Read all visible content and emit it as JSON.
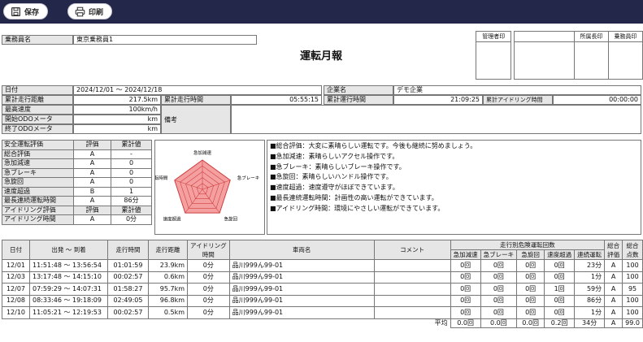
{
  "toolbar": {
    "save_label": "保存",
    "print_label": "印刷"
  },
  "driver": {
    "label": "乗務員名",
    "value": "東京乗務員1"
  },
  "report_title": "運転月報",
  "stamps": [
    "管理者印",
    "所属長印",
    "乗務員印"
  ],
  "period": {
    "label": "日付",
    "value": "2024/12/01 ～ 2024/12/18"
  },
  "company": {
    "label": "企業名",
    "value": "デモ企業"
  },
  "summary": {
    "distance_label": "累計走行距離",
    "distance": "217.5km",
    "drive_time_label": "累計走行時間",
    "drive_time": "05:55:15",
    "op_time_label": "累計運行時間",
    "op_time": "21:09:25",
    "idle_label": "累計アイドリング時間",
    "idle": "00:00:00",
    "max_speed_label": "最高速度",
    "max_speed": "100km/h",
    "start_odo_label": "開始ODOメータ",
    "start_odo": "km",
    "end_odo_label": "終了ODOメータ",
    "end_odo": "km",
    "remarks_label": "備考"
  },
  "evaluation": {
    "header": [
      "安全運転評価",
      "評価",
      "累計値"
    ],
    "rows": [
      [
        "総合評価",
        "A",
        "-"
      ],
      [
        "急加減速",
        "A",
        "0"
      ],
      [
        "急ブレーキ",
        "A",
        "0"
      ],
      [
        "急旋回",
        "A",
        "0"
      ],
      [
        "速度超過",
        "B",
        "1"
      ],
      [
        "最長連続運転時間",
        "A",
        "86分"
      ]
    ],
    "idle_header": [
      "アイドリング評価",
      "評価",
      "累計値"
    ],
    "idle_row": [
      "アイドリング時間",
      "A",
      "0分"
    ]
  },
  "radar": {
    "axes": [
      "急加減速",
      "急ブレーキ",
      "急旋回",
      "速度超過",
      "運転時間"
    ],
    "fill_color": "#f5a0a0",
    "stroke_color": "#d04040",
    "levels": 5
  },
  "comments": [
    "■総合評価：大変に素晴らしい運転です。今後も継続に努めましょう。",
    "■急加減速：素晴らしいアクセル操作です。",
    "■急ブレーキ：素晴らしいブレーキ操作です。",
    "■急旋回：素晴らしいハンドル操作です。",
    "■速度超過：速度遵守がほぼできています。",
    "■最長連続運転時間：計画性の高い運転ができています。",
    "■アイドリング時間：環境にやさしい運転ができています。"
  ],
  "table": {
    "headers": {
      "date": "日付",
      "depart_arrive": "出発 ～ 到着",
      "drive_time": "走行時間",
      "distance": "走行距離",
      "idling_line1": "アイドリング",
      "idling_line2": "時間",
      "vehicle": "車両名",
      "comment": "コメント",
      "danger_group": "走行別危険運転回数",
      "danger": [
        "急加減速",
        "急ブレーキ",
        "急旋回",
        "速度超過",
        "連続運転"
      ],
      "overall_line1": "総合",
      "overall_line2": "評価",
      "score_line1": "総合",
      "score_line2": "点数"
    },
    "rows": [
      [
        "12/01",
        "11:51:48 ～ 13:56:54",
        "01:01:59",
        "23.9km",
        "0分",
        "品川999ん99-01",
        "",
        "0回",
        "0回",
        "0回",
        "0回",
        "23分",
        "A",
        "100"
      ],
      [
        "12/03",
        "13:17:48 ～ 14:15:10",
        "00:02:57",
        "0.6km",
        "0分",
        "品川999ん99-01",
        "",
        "0回",
        "0回",
        "0回",
        "0回",
        "1分",
        "A",
        "100"
      ],
      [
        "12/07",
        "07:59:29 ～ 14:07:31",
        "01:58:27",
        "95.7km",
        "0分",
        "品川999ん99-01",
        "",
        "0回",
        "0回",
        "0回",
        "1回",
        "59分",
        "A",
        "95"
      ],
      [
        "12/08",
        "08:33:46 ～ 19:18:09",
        "02:49:05",
        "96.8km",
        "0分",
        "品川999ん99-01",
        "",
        "0回",
        "0回",
        "0回",
        "0回",
        "86分",
        "A",
        "100"
      ],
      [
        "12/10",
        "11:05:21 ～ 12:19:53",
        "00:02:57",
        "0.5km",
        "0分",
        "品川999ん99-01",
        "",
        "0回",
        "0回",
        "0回",
        "0回",
        "1分",
        "A",
        "100"
      ]
    ],
    "average_label": "平均",
    "average": [
      "0.0回",
      "0.0回",
      "0.0回",
      "0.2回",
      "34分",
      "A",
      "99.0"
    ]
  },
  "colors": {
    "toolbar_bg": "#23274a",
    "header_bg": "#e6e6e6"
  }
}
